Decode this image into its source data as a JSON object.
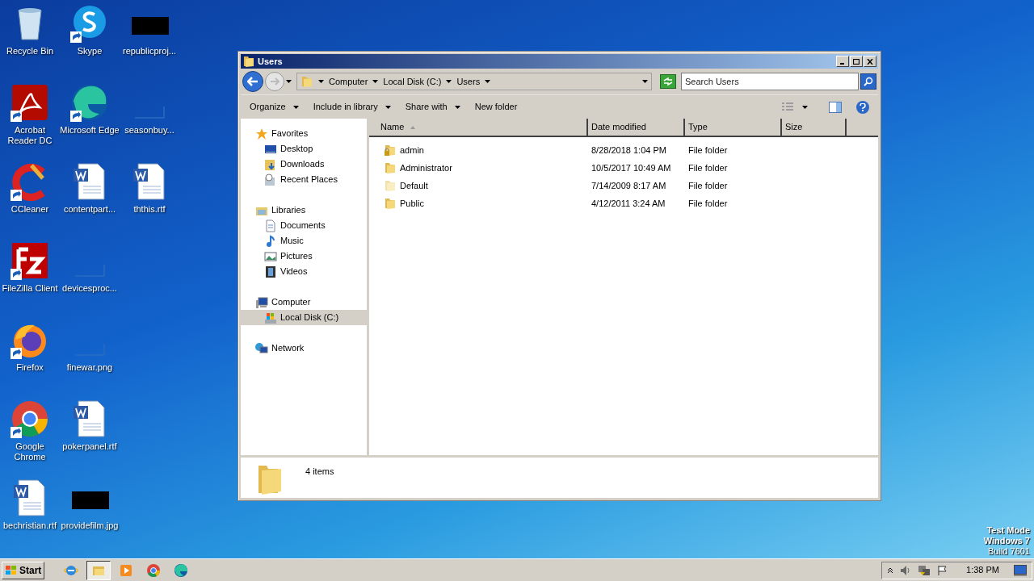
{
  "desktop_icons": [
    {
      "label": "Recycle Bin",
      "kind": "recycle",
      "shortcut": false
    },
    {
      "label": "Acrobat Reader DC",
      "kind": "acrobat",
      "shortcut": true
    },
    {
      "label": "CCleaner",
      "kind": "ccleaner",
      "shortcut": true
    },
    {
      "label": "FileZilla Client",
      "kind": "filezilla",
      "shortcut": true
    },
    {
      "label": "Firefox",
      "kind": "firefox",
      "shortcut": true
    },
    {
      "label": "Google Chrome",
      "kind": "chrome",
      "shortcut": true
    },
    {
      "label": "bechristian.rtf",
      "kind": "word",
      "shortcut": false
    },
    {
      "label": "Skype",
      "kind": "skype",
      "shortcut": true
    },
    {
      "label": "Microsoft Edge",
      "kind": "edge",
      "shortcut": true
    },
    {
      "label": "contentpart...",
      "kind": "word",
      "shortcut": false
    },
    {
      "label": "devicesproc...",
      "kind": "blank",
      "shortcut": false
    },
    {
      "label": "finewar.png",
      "kind": "blank",
      "shortcut": false
    },
    {
      "label": "pokerpanel.rtf",
      "kind": "word",
      "shortcut": false
    },
    {
      "label": "providefilm.jpg",
      "kind": "dark",
      "shortcut": false
    },
    {
      "label": "republicproj...",
      "kind": "dark",
      "shortcut": false
    },
    {
      "label": "seasonbuy...",
      "kind": "blank",
      "shortcut": false
    },
    {
      "label": "ththis.rtf",
      "kind": "word",
      "shortcut": false
    }
  ],
  "window": {
    "title": "Users",
    "breadcrumb": [
      "Computer",
      "Local Disk (C:)",
      "Users"
    ],
    "search": {
      "placeholder": "Search Users"
    },
    "toolbar": [
      {
        "label": "Organize",
        "dropdown": true
      },
      {
        "label": "Include in library",
        "dropdown": true
      },
      {
        "label": "Share with",
        "dropdown": true
      },
      {
        "label": "New folder",
        "dropdown": false
      }
    ],
    "nav": [
      {
        "label": "Favorites",
        "kind": "star",
        "selected": false,
        "children": [
          {
            "label": "Desktop",
            "kind": "desktop",
            "selected": false
          },
          {
            "label": "Downloads",
            "kind": "downloads",
            "selected": false
          },
          {
            "label": "Recent Places",
            "kind": "recent",
            "selected": false
          }
        ]
      },
      {
        "label": "Libraries",
        "kind": "libraries",
        "selected": false,
        "children": [
          {
            "label": "Documents",
            "kind": "documents",
            "selected": false
          },
          {
            "label": "Music",
            "kind": "music",
            "selected": false
          },
          {
            "label": "Pictures",
            "kind": "pictures",
            "selected": false
          },
          {
            "label": "Videos",
            "kind": "videos",
            "selected": false
          }
        ]
      },
      {
        "label": "Computer",
        "kind": "computer",
        "selected": false,
        "children": [
          {
            "label": "Local Disk (C:)",
            "kind": "disk",
            "selected": true
          }
        ]
      },
      {
        "label": "Network",
        "kind": "network",
        "selected": false
      }
    ],
    "columns": [
      {
        "label": "Name",
        "sorted": true
      },
      {
        "label": "Date modified",
        "sorted": false
      },
      {
        "label": "Type",
        "sorted": false
      },
      {
        "label": "Size",
        "sorted": false
      }
    ],
    "rows": [
      {
        "name": "admin",
        "date": "8/28/2018 1:04 PM",
        "type": "File folder",
        "kind": "locked"
      },
      {
        "name": "Administrator",
        "date": "10/5/2017 10:49 AM",
        "type": "File folder",
        "kind": "folder"
      },
      {
        "name": "Default",
        "date": "7/14/2009 8:17 AM",
        "type": "File folder",
        "kind": "faded"
      },
      {
        "name": "Public",
        "date": "4/12/2011 3:24 AM",
        "type": "File folder",
        "kind": "folder"
      }
    ],
    "status": "4 items"
  },
  "watermark_text": [
    "Test Mode",
    "Windows 7",
    "Build 7601"
  ],
  "taskbar": {
    "start": "Start",
    "apps": [
      {
        "kind": "ie",
        "selected": false
      },
      {
        "kind": "explorer",
        "selected": true
      },
      {
        "kind": "media",
        "selected": false
      },
      {
        "kind": "chrome",
        "selected": false
      },
      {
        "kind": "edge",
        "selected": false
      }
    ],
    "clock": "1:38 PM"
  }
}
